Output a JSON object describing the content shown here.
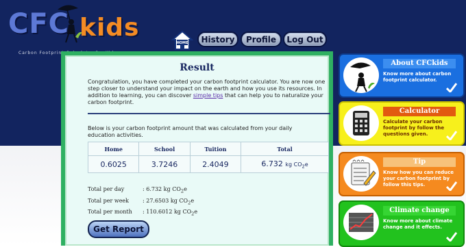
{
  "logo": {
    "cfc": "CFC",
    "kids": "kids",
    "tagline": "Carbon Footprint Calculator for Kids"
  },
  "nav": {
    "home_label": "HOME",
    "history_label": "History",
    "profile_label": "Profile",
    "logout_label": "Log Out"
  },
  "result": {
    "title": "Result",
    "intro_before_link": "Congratulation, you have completed your carbon footprint calculator. You are now one step closer to understand your impact on the earth and how you use its resources. In addition to learning, you can discover ",
    "intro_link": "simple tips",
    "intro_after_link": " that can help you to naturalize your carbon footprint.",
    "description": "Below is your carbon footprint amount that was calculated from your daily education activities.",
    "table": {
      "headers": [
        "Home",
        "School",
        "Tuition",
        "Total"
      ],
      "values": [
        "0.6025",
        "3.7246",
        "2.4049",
        "6.732"
      ],
      "total_unit": "kg CO",
      "total_unit_sub": "2",
      "total_unit_end": "e"
    },
    "totals": [
      {
        "label": "Total per day",
        "value": ": 6.732 kg CO",
        "sub": "2",
        "end": "e"
      },
      {
        "label": "Total per week",
        "value": ": 27.6503 kg CO",
        "sub": "2",
        "end": "e"
      },
      {
        "label": "Total per month",
        "value": ": 110.6012 kg CO",
        "sub": "2",
        "end": "e"
      }
    ],
    "report_button": "Get Report"
  },
  "cards": [
    {
      "title": "About CFCkids",
      "text": "Know more about carbon footprint calculator.",
      "color": "#1a6fe0",
      "icon": "girl-umbrella-icon"
    },
    {
      "title": "Calculator",
      "text": "Calculate your carbon footprint by follow the questions given.",
      "color": "#f7f01c",
      "icon": "calculator-icon"
    },
    {
      "title": "Tip",
      "text": "Know how you can reduce your carbon footprint by follow this tips.",
      "color": "#f58a1f",
      "icon": "notepad-icon"
    },
    {
      "title": "Climate change",
      "text": "Know more about climate change and it effects.",
      "color": "#22c21e",
      "icon": "rising-graph-icon"
    }
  ]
}
